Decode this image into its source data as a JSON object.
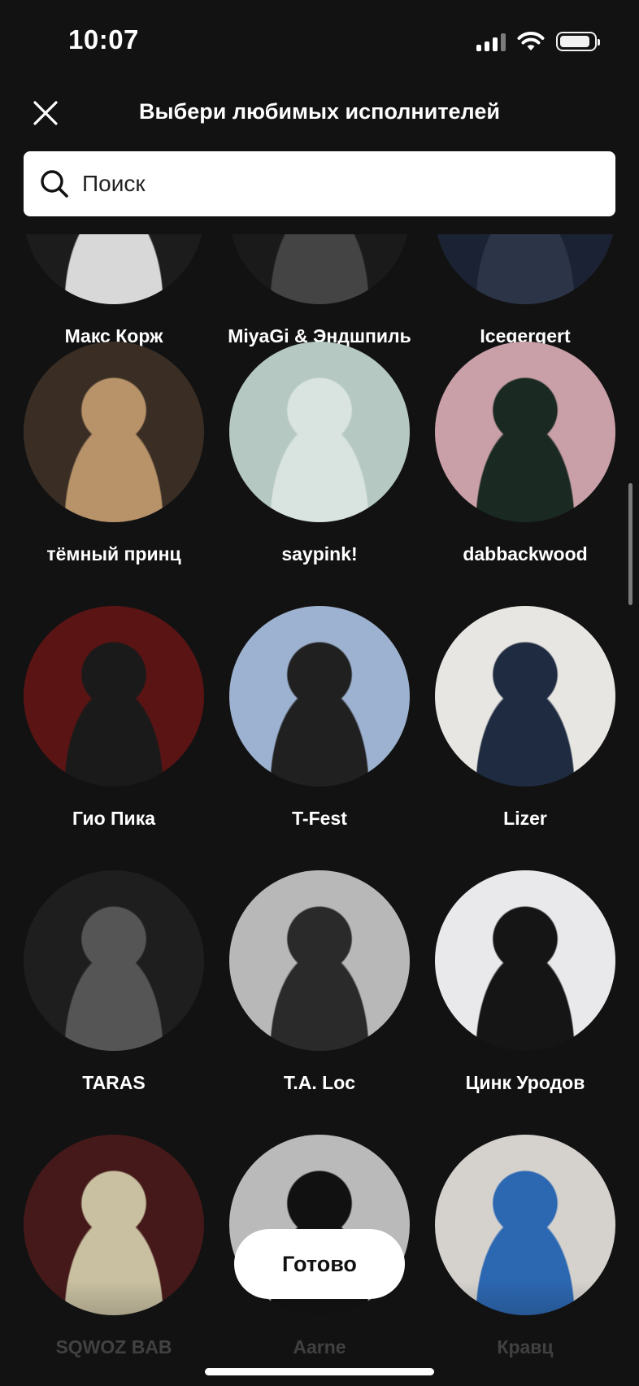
{
  "status_bar": {
    "time": "10:07"
  },
  "header": {
    "title": "Выбери любимых исполнителей"
  },
  "search": {
    "placeholder": "Поиск"
  },
  "artists": [
    {
      "name": "Макс Корж",
      "palette": [
        "#1c1c1c",
        "#d8d8d8"
      ]
    },
    {
      "name": "MiyaGi & Эндшпиль",
      "palette": [
        "#1a1a1a",
        "#444444"
      ]
    },
    {
      "name": "Icegergert",
      "palette": [
        "#1b2233",
        "#2c3548"
      ]
    },
    {
      "name": "тёмный принц",
      "palette": [
        "#3a2e24",
        "#b8936a"
      ]
    },
    {
      "name": "saypink!",
      "palette": [
        "#b5c8c2",
        "#d9e3df"
      ]
    },
    {
      "name": "dabbackwood",
      "palette": [
        "#c9a0a8",
        "#1a2a22"
      ]
    },
    {
      "name": "Гио Пика",
      "palette": [
        "#5a1414",
        "#1a1a1a"
      ]
    },
    {
      "name": "T-Fest",
      "palette": [
        "#9db2d0",
        "#202020"
      ]
    },
    {
      "name": "Lizer",
      "palette": [
        "#e8e6e2",
        "#1f2b40"
      ]
    },
    {
      "name": "TARAS",
      "palette": [
        "#1e1e1e",
        "#555555"
      ]
    },
    {
      "name": "T.A. Loc",
      "palette": [
        "#b8b8b8",
        "#2a2a2a"
      ]
    },
    {
      "name": "Цинк Уродов",
      "palette": [
        "#e9e9ec",
        "#151515"
      ]
    },
    {
      "name": "SQWOZ BAB",
      "palette": [
        "#4a1a1a",
        "#d9cfae"
      ]
    },
    {
      "name": "Aarne",
      "palette": [
        "#c9c9c9",
        "#111111"
      ]
    },
    {
      "name": "Кравц",
      "palette": [
        "#e6e3df",
        "#2f6fbf"
      ]
    }
  ],
  "done_button": {
    "label": "Готово"
  }
}
